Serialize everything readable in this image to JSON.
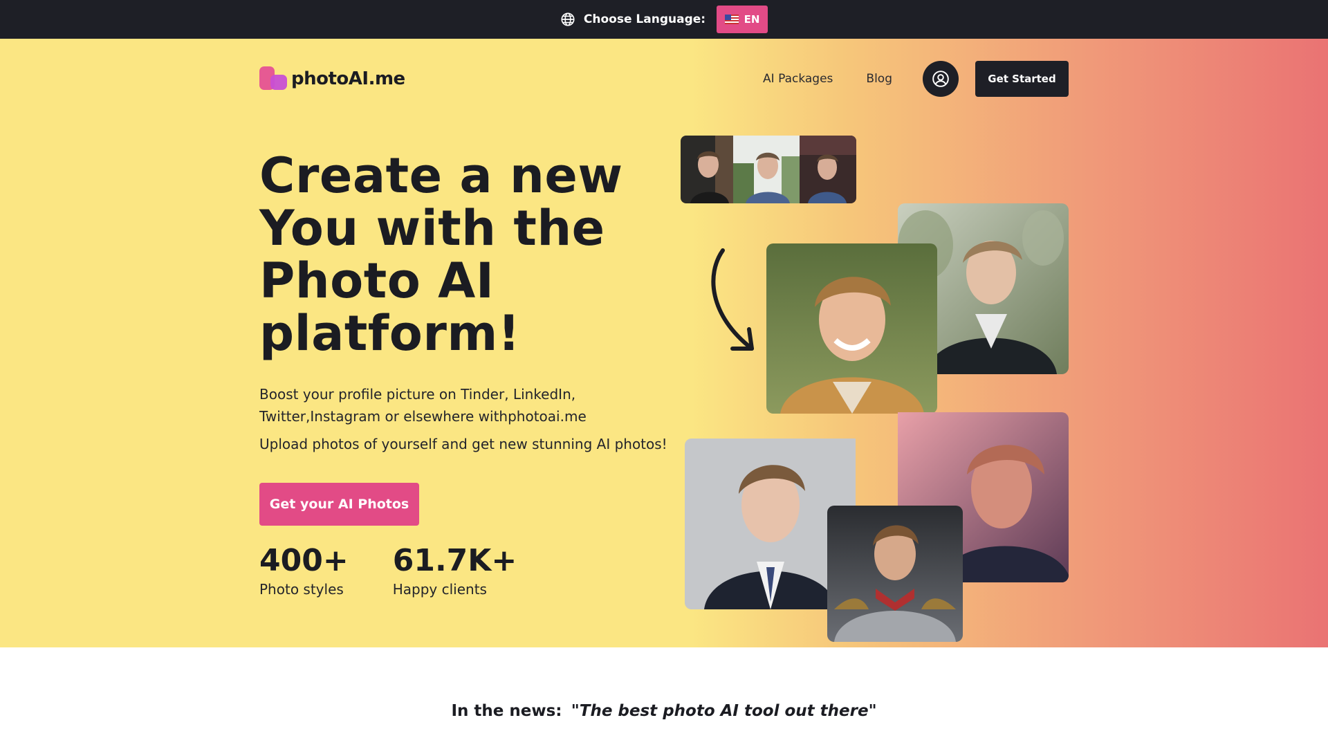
{
  "language_bar": {
    "label": "Choose Language:",
    "current": "EN"
  },
  "brand": {
    "name": "photoAI.me"
  },
  "nav": {
    "links": [
      "AI Packages",
      "Blog"
    ],
    "cta": "Get Started"
  },
  "hero": {
    "headline_lines": [
      "Create a new",
      "You with the",
      "Photo AI",
      "platform!"
    ],
    "description": "Boost your profile picture on Tinder, LinkedIn, Twitter,Instagram or elsewhere withphotoai.me",
    "description2": "Upload photos of yourself and get new stunning AI photos!",
    "cta": "Get your AI Photos",
    "stats": [
      {
        "value": "400+",
        "label": "Photo styles"
      },
      {
        "value": "61.7K+",
        "label": "Happy clients"
      }
    ]
  },
  "news": {
    "label": "In the news:",
    "quote": "\"The best photo AI tool out there\""
  },
  "colors": {
    "accent": "#e24b86",
    "dark": "#1e1f26",
    "hero_start": "#fbe683",
    "hero_end": "#ea7373"
  }
}
